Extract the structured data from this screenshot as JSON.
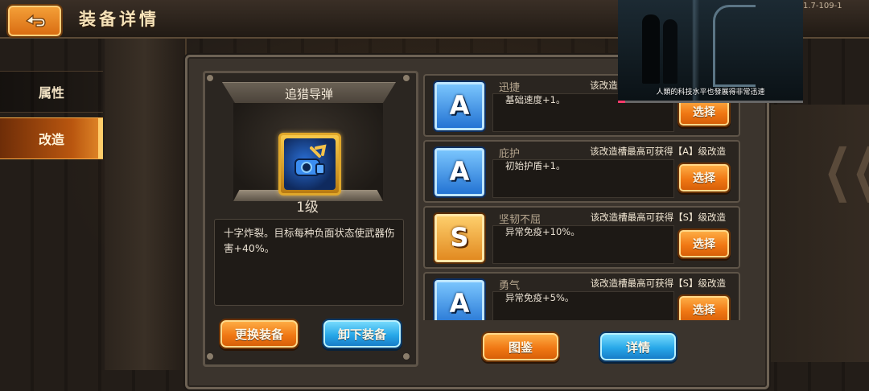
{
  "header": {
    "title": "装备详情",
    "level_code": "1.7-109-1"
  },
  "tabs": [
    {
      "label": "属性"
    },
    {
      "label": "改造"
    }
  ],
  "equipment": {
    "name": "追猎导弹",
    "level": "1级",
    "description": "十字炸裂。目标每种负面状态使武器伤害+40%。",
    "icon": "missile-launcher-icon",
    "buttons": {
      "replace": "更换装备",
      "unequip": "卸下装备"
    }
  },
  "slots": [
    {
      "grade": "A",
      "name": "迅捷",
      "hint": "该改造槽最高可获得【A】级改造",
      "effect": "基础速度+1。",
      "button": "选择"
    },
    {
      "grade": "A",
      "name": "庇护",
      "hint": "该改造槽最高可获得【A】级改造",
      "effect": "初始护盾+1。",
      "button": "选择"
    },
    {
      "grade": "S",
      "name": "坚韧不屈",
      "hint": "该改造槽最高可获得【S】级改造",
      "effect": "异常免疫+10%。",
      "button": "选择"
    },
    {
      "grade": "A",
      "name": "勇气",
      "hint": "该改造槽最高可获得【S】级改造",
      "effect": "异常免疫+5%。",
      "button": "选择"
    }
  ],
  "footer_buttons": {
    "catalog": "图鉴",
    "details": "详情"
  },
  "video_overlay": {
    "caption": "人類的科技水平也發展得非常迅速",
    "progress": 0.04
  },
  "colors": {
    "accent_orange": "#f07814",
    "accent_blue": "#27a7e8",
    "grade_A": "#1f6fd1",
    "grade_S": "#e0861c"
  }
}
